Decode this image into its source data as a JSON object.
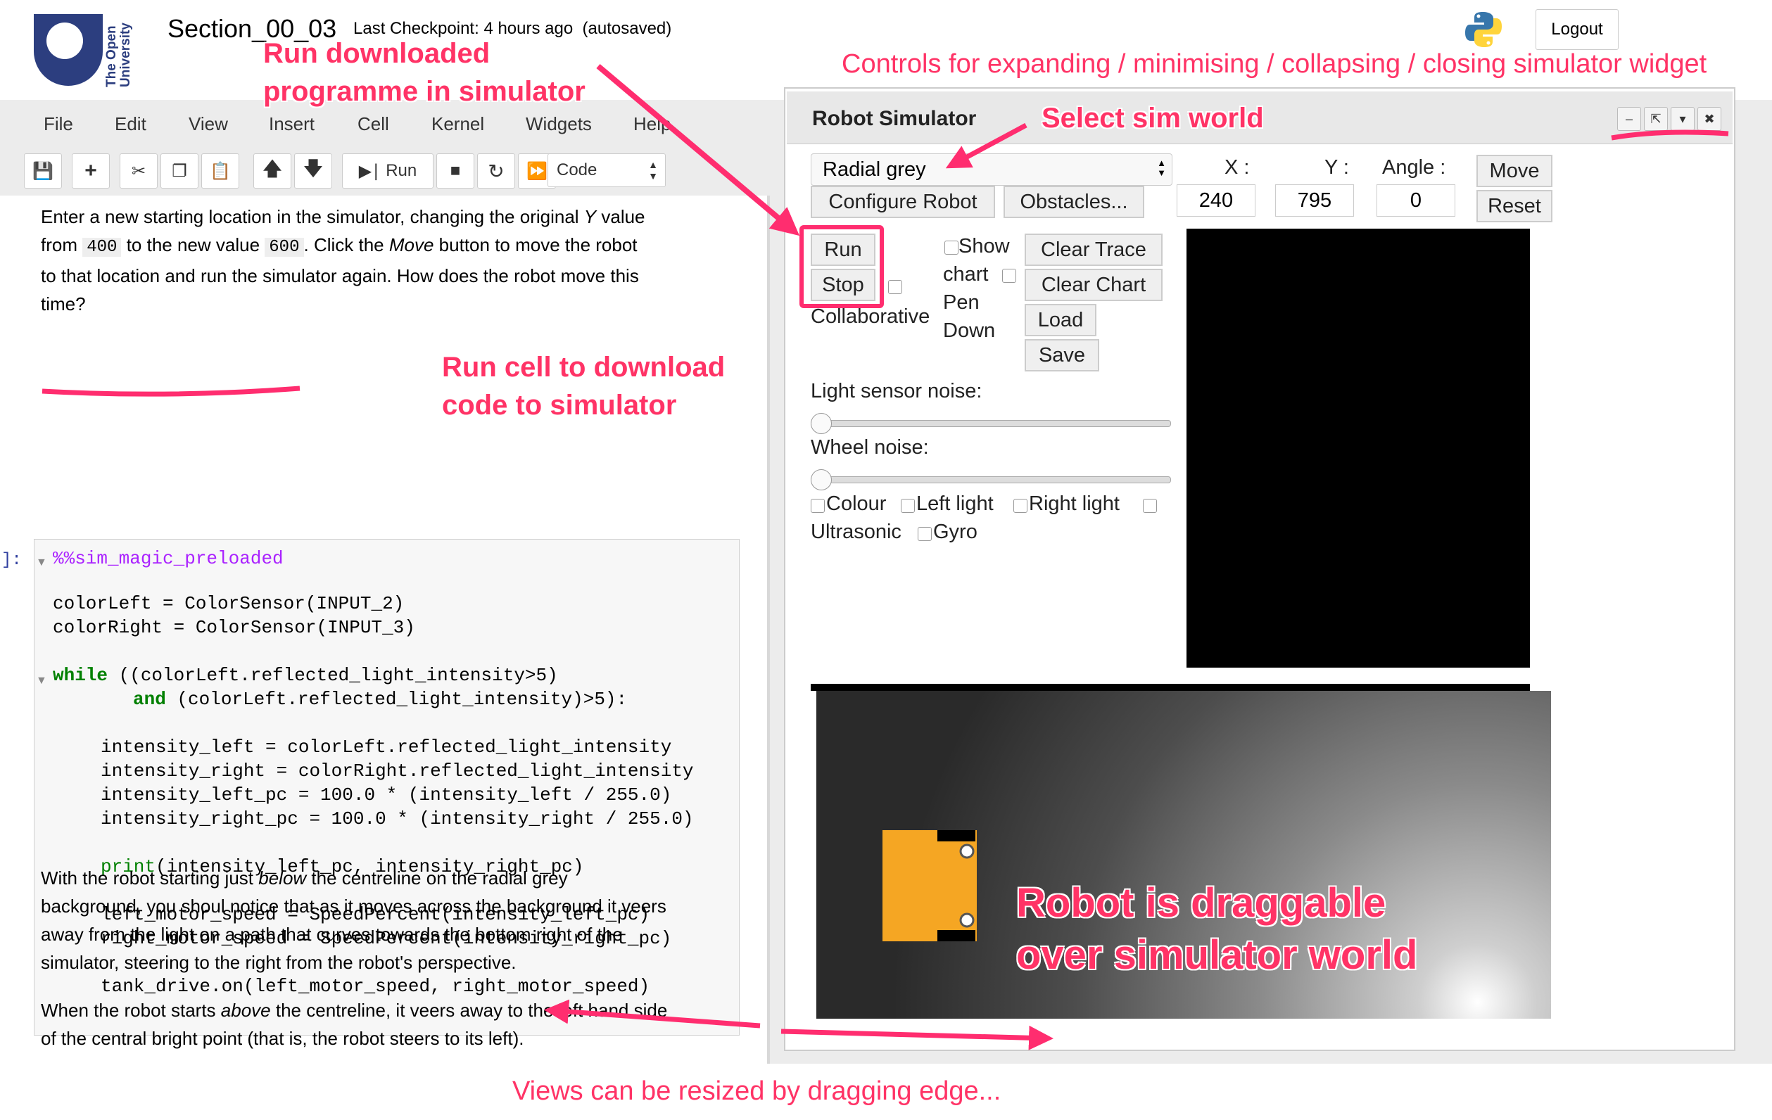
{
  "header": {
    "notebook_title": "Section_00_03",
    "checkpoint": "Last Checkpoint: 4 hours ago  (autosaved)",
    "logo_text_1": "The Open",
    "logo_text_2": "University",
    "logout": "Logout"
  },
  "menu": [
    "File",
    "Edit",
    "View",
    "Insert",
    "Cell",
    "Kernel",
    "Widgets",
    "Help"
  ],
  "toolbar": {
    "run_label": "Run",
    "cell_type": "Code"
  },
  "notebook": {
    "para1_a": "Enter a new starting location in the simulator, changing the original ",
    "para1_y": "Y",
    "para1_b": " value",
    "para1_from": "from",
    "para1_old": "400",
    "para1_c": "to the new value",
    "para1_new": "600",
    "para1_d": ". Click the ",
    "para1_move": "Move",
    "para1_e": " button to move the robot",
    "para1_line3": "to that location and run the simulator again. How does the robot move this",
    "para1_line4": "time?",
    "prompt": "]:",
    "code": {
      "magic": "%%sim_magic_preloaded",
      "l1": "colorLeft = ColorSensor(INPUT_2)",
      "l2": "colorRight = ColorSensor(INPUT_3)",
      "l3": "((colorLeft.reflected_light_intensity>5)",
      "l3_kw": "while",
      "l4_kw": "and",
      "l4": "(colorLeft.reflected_light_intensity)>5):",
      "l5": "intensity_left = colorLeft.reflected_light_intensity",
      "l6": "intensity_right = colorRight.reflected_light_intensity",
      "l7": "intensity_left_pc = 100.0 * (intensity_left / 255.0)",
      "l8": "intensity_right_pc = 100.0 * (intensity_right / 255.0)",
      "l9": "(intensity_left_pc, intensity_right_pc)",
      "l9_fn": "print",
      "l10": "left_motor_speed = SpeedPercent(intensity_left_pc)",
      "l11": "right_motor_speed = SpeedPercent(intensity_right_pc)",
      "l12": "tank_drive.on(left_motor_speed, right_motor_speed)"
    },
    "para2_a": "With the robot starting just ",
    "para2_below": "below",
    "para2_b": " the centreline on the radial grey",
    "para2_l2": "background, you shoul notice that as it moves across the background it veers",
    "para2_l3": "away from the light on a path that curves towards the bottom right of the",
    "para2_l4": "simulator, steering to the right from the robot's perspective.",
    "para3_a": "When the robot starts ",
    "para3_above": "above",
    "para3_b": " the centreline, it veers away to the left hand side",
    "para3_l2": "of the central bright point (that is, the robot steers to its left)."
  },
  "simulator": {
    "title": "Robot Simulator",
    "world_select": "Radial grey",
    "configure_robot": "Configure Robot",
    "obstacles": "Obstacles...",
    "x_label": "X :",
    "y_label": "Y :",
    "angle_label": "Angle :",
    "x_value": "240",
    "y_value": "795",
    "angle_value": "0",
    "move": "Move",
    "reset": "Reset",
    "run": "Run",
    "stop": "Stop",
    "collaborative": "Collaborative",
    "show_chart_1": "Show",
    "show_chart_2": "chart",
    "pen_down_1": "Pen",
    "pen_down_2": "Down",
    "clear_trace": "Clear Trace",
    "clear_chart": "Clear Chart",
    "load": "Load",
    "save": "Save",
    "light_noise": "Light sensor noise:",
    "light_noise_level": 0,
    "wheel_noise": "Wheel noise:",
    "wheel_noise_level": 0,
    "colour": "Colour",
    "left_light": "Left light",
    "right_light": "Right light",
    "ultrasonic": "Ultrasonic",
    "gyro": "Gyro"
  },
  "annotations": {
    "run_downloaded_1": "Run downloaded",
    "run_downloaded_2": "programme in simulator",
    "controls": "Controls for expanding / minimising / collapsing / closing simulator widget",
    "select_world": "Select sim world",
    "run_cell_1": "Run cell to download",
    "run_cell_2": "code to simulator",
    "robot_drag_1": "Robot is draggable",
    "robot_drag_2": "over simulator world",
    "resize": "Views can be resized by dragging edge..."
  },
  "colors": {
    "annotation": "#ff3366",
    "ou_blue": "#2c3e7f",
    "robot": "#f5a623"
  }
}
